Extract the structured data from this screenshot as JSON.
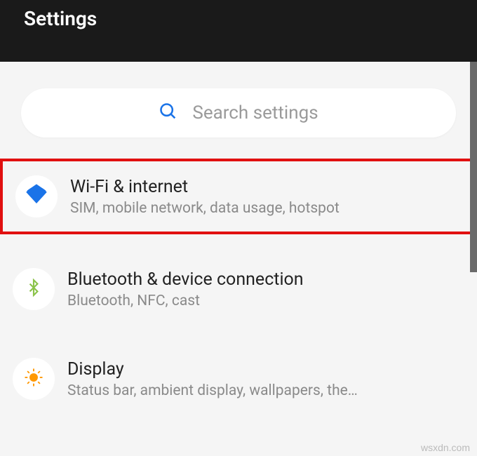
{
  "header": {
    "title": "Settings"
  },
  "search": {
    "placeholder": "Search settings"
  },
  "items": [
    {
      "title": "Wi-Fi & internet",
      "subtitle": "SIM, mobile network, data usage, hotspot",
      "icon": "wifi",
      "highlighted": true
    },
    {
      "title": "Bluetooth & device connection",
      "subtitle": "Bluetooth, NFC, cast",
      "icon": "bluetooth",
      "highlighted": false
    },
    {
      "title": "Display",
      "subtitle": "Status bar, ambient display, wallpapers, the…",
      "icon": "brightness",
      "highlighted": false
    }
  ],
  "watermark": "wsxdn.com"
}
